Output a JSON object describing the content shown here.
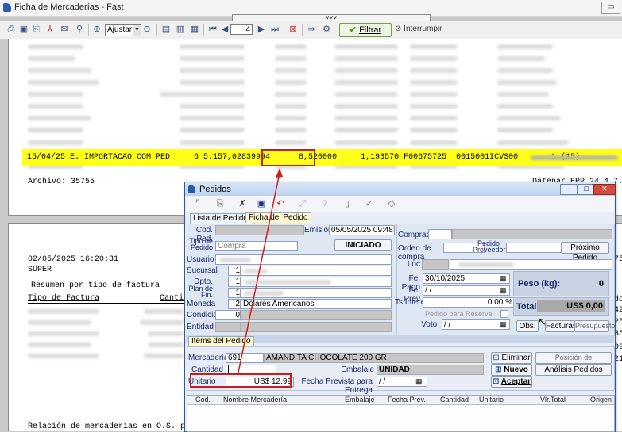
{
  "app": {
    "title": "Ficha de Mercaderías - Fast"
  },
  "toolbar": {
    "zoom": "Ajustar",
    "page": "4",
    "filter_label": "Filtrar",
    "interrupt_label": "Interrumpir"
  },
  "report": {
    "highlight_row": "15/04/25 E. IMPORTACAO COM PED     6 5.157,02839994      8,520000     1,193570 F00675725  0015001ICVS00       1 (15)",
    "highlight_value": "8,520000",
    "archivo": "Archivo: 35755",
    "version": "Datenar ERP 24.4.7.9",
    "date": "02/05/2025 16:20:31",
    "company": "SUPER",
    "summary_title": "Resumen por tipo de factura",
    "col_tipo": "Tipo de Factura",
    "col_cantidad": "Cantida",
    "footer": "Relación de mercaderias en O.S. pendientes",
    "right_nums": [
      "75",
      "do",
      "42",
      "25",
      "35",
      "09",
      "21"
    ]
  },
  "dialog": {
    "title": "Pedidos",
    "tabs": [
      "Lista de Pedidos",
      "Ficha del Pedido"
    ],
    "cod_ped_label": "Cod. Ped.",
    "emision_label": "Emisión",
    "emision": "05/05/2025 09:48:41",
    "tipo_pedido_label": "Tipo de Pedido",
    "tipo_pedido": "Compra",
    "status": "INICIADO",
    "usuario_label": "Usuario",
    "sucursal_label": "Sucursal",
    "sucursal": "1",
    "dpto_label": "Dpto.",
    "dpto": "1",
    "plan_fin_label": "Plan de Fin.",
    "plan_fin": "1",
    "moneda_label": "Moneda",
    "moneda_code": "2",
    "moneda": "Dólares Americanos",
    "condicion_label": "Condición",
    "condicion": "0",
    "entidad_label": "Entidad",
    "comprador_label": "Comprador",
    "orden_compra_label": "Orden de compra",
    "pedido_proveedor_label": "Pedido Proveedor",
    "proximo_pedido": "Próximo Pedido",
    "loc_label": "Loc",
    "fe_pago_label": "Fe. Pago",
    "fe_pago": "30/10/2025",
    "fe_prev_label": "Fe. Prev",
    "fe_prev": "/ /",
    "ts_interes_label": "Ts.Interés",
    "ts_interes": "0.00 %",
    "pedido_reserva": "Pedido para Reserva",
    "voto_label": "Voto.",
    "voto": "/ /",
    "peso_label": "Peso (kg):",
    "peso": "0",
    "total_label": "Total:",
    "total": "US$ 0,00",
    "obs_label": "Obs.",
    "facturas_label": "Facturas",
    "presupuesto_label": "Presupuesto",
    "items_tab": "Items del Pedido",
    "mercaderia_label": "Mercadería",
    "mercaderia_code": "691",
    "mercaderia": "AMANDITA CHOCOLATE 200 GR",
    "cantidad_label": "Cantidad",
    "embalaje_label": "Embalaje",
    "embalaje": "UNIDAD",
    "unitario_label": "Unitario",
    "unitario": "US$ 12,99",
    "fecha_prevista_label": "Fecha Prevista para Entrega",
    "fecha_prevista": "/ /",
    "eliminar": "Eliminar",
    "nuevo": "Nuevo",
    "aceptar": "Aceptar",
    "posicion": "Posición de Mercadería",
    "analisis": "Análisis Pedidos",
    "grid_headers": [
      "Cod.",
      "Nombre Mercadería",
      "Embalaje",
      "Fecha Prev.",
      "Cantidad",
      "Unitario",
      "Vlr.Total",
      "Origen"
    ]
  }
}
